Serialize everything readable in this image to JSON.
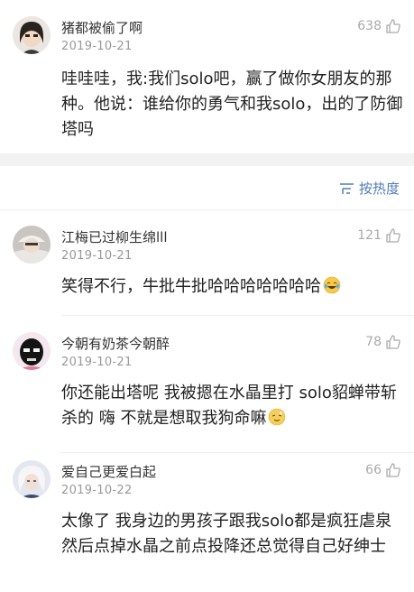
{
  "top_comment": {
    "username": "猪都被偷了啊",
    "date": "2019-10-21",
    "likes": "638",
    "text": "哇哇哇，我:我们solo吧，赢了做你女朋友的那种。他说：谁给你的勇气和我solo，出的了防御塔吗",
    "avatar": "avatar-dark-hair-person"
  },
  "sortbar": {
    "label": "按热度",
    "icon": "sort-lines-icon"
  },
  "comments": [
    {
      "username": "江梅已过柳生绵lll",
      "date": "2019-10-21",
      "likes": "121",
      "text": "笑得不行，牛批牛批哈哈哈哈哈哈哈",
      "emoji": "laughing-tears-emoji",
      "avatar": "avatar-girl-hat"
    },
    {
      "username": "今朝有奶茶今朝醉",
      "date": "2019-10-21",
      "likes": "78",
      "text": "你还能出塔呢 我被摁在水晶里打 solo貂蝉带斩杀的 嗨 不就是想取我狗命嘛",
      "emoji": "cry-laugh-emoji",
      "avatar": "avatar-black-mask"
    },
    {
      "username": "爱自己更爱白起",
      "date": "2019-10-22",
      "likes": "66",
      "text": "太像了 我身边的男孩子跟我solo都是疯狂虐泉然后点掉水晶之前点投降还总觉得自己好绅士",
      "avatar": "avatar-white-hair-character"
    }
  ],
  "colors": {
    "link_blue": "#4f7db8",
    "meta_gray": "#999999",
    "section_gap": "#f2f2f2"
  }
}
